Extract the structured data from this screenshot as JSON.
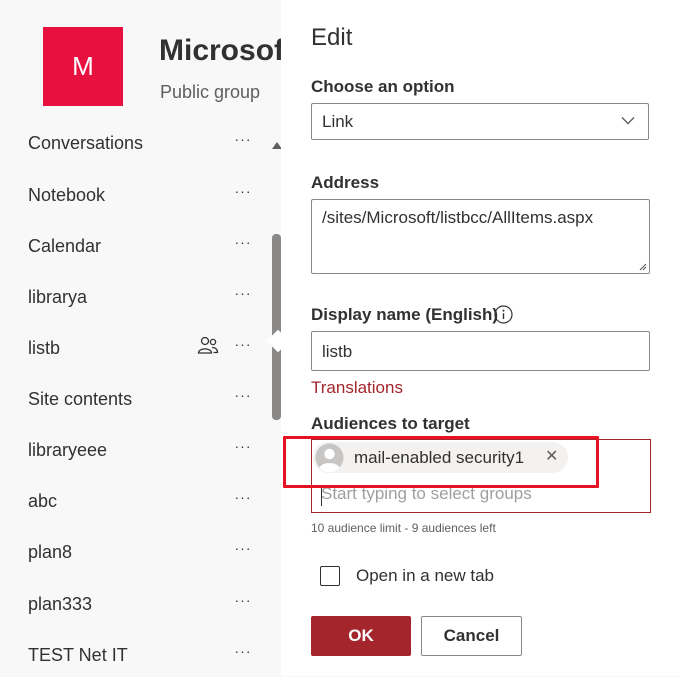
{
  "site": {
    "logo_letter": "M",
    "title": "Microsoft",
    "subtitle": "Public group",
    "logo_color": "#e8103e"
  },
  "nav": {
    "more_label": "···",
    "items": [
      {
        "label": "Conversations"
      },
      {
        "label": "Notebook"
      },
      {
        "label": "Calendar"
      },
      {
        "label": "librarya"
      },
      {
        "label": "listb",
        "icon": "people-audience-icon"
      },
      {
        "label": "Site contents"
      },
      {
        "label": "libraryeee"
      },
      {
        "label": "abc"
      },
      {
        "label": "plan8"
      },
      {
        "label": "plan333"
      },
      {
        "label": "TEST Net IT"
      }
    ]
  },
  "panel": {
    "title": "Edit",
    "option_label": "Choose an option",
    "option_value": "Link",
    "address_label": "Address",
    "address_value": "/sites/Microsoft/listbcc/AllItems.aspx",
    "display_name_label": "Display name (English)",
    "display_name_value": "listb",
    "translations_link": "Translations",
    "audiences_label": "Audiences to target",
    "audience_chip": "mail-enabled security1",
    "audience_remove": "✕",
    "audience_placeholder": "Start typing to select groups",
    "audience_helper": "10 audience limit - 9 audiences left",
    "new_tab_label": "Open in a new tab",
    "new_tab_checked": false,
    "ok_label": "OK",
    "cancel_label": "Cancel",
    "accent_color": "#a4262c",
    "highlight_color": "#e81123"
  }
}
